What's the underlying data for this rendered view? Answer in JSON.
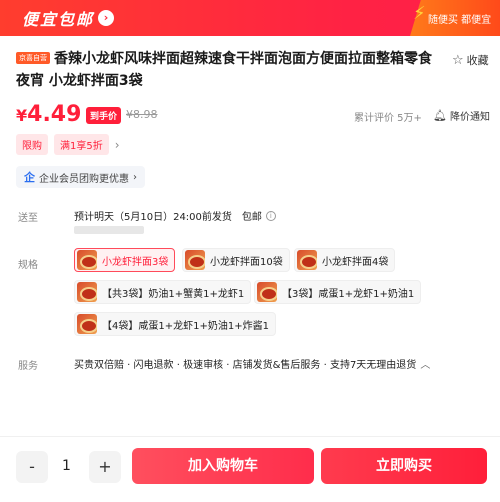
{
  "banner": {
    "title": "便宜包邮",
    "arrow": "›",
    "ribbon_text": "随便买 都便宜"
  },
  "product": {
    "self_tag": "京喜自营",
    "title": "香辣小龙虾风味拌面超辣速食干拌面泡面方便面拉面整箱零食夜宵 小龙虾拌面3袋",
    "fav_label": "收藏"
  },
  "price": {
    "currency": "¥",
    "value": "4.49",
    "hand_tag": "到手价",
    "original": "¥8.98",
    "reviews": "累计评价 5万+",
    "notify": "降价通知"
  },
  "promos": [
    "限购",
    "满1享5折"
  ],
  "corp": {
    "label": "企业会员团购更优惠",
    "chevron": "›"
  },
  "shipping": {
    "label": "送至",
    "text": "预计明天（5月10日）24:00前发货",
    "free": "包邮",
    "info": "i"
  },
  "specs": {
    "label": "规格",
    "options": [
      {
        "label": "小龙虾拌面3袋",
        "selected": true
      },
      {
        "label": "小龙虾拌面10袋",
        "selected": false
      },
      {
        "label": "小龙虾拌面4袋",
        "selected": false
      },
      {
        "label": "【共3袋】奶油1+蟹黄1+龙虾1",
        "selected": false
      },
      {
        "label": "【3袋】咸蛋1+龙虾1+奶油1",
        "selected": false
      },
      {
        "label": "【4袋】咸蛋1+龙虾1+奶油1+炸酱1",
        "selected": false
      }
    ]
  },
  "service": {
    "label": "服务",
    "text": "买贵双倍赔 · 闪电退款 · 极速审核 · 店铺发货&售后服务 · 支持7天无理由退货"
  },
  "bottom": {
    "minus": "-",
    "qty": "1",
    "plus": "+",
    "add_cart": "加入购物车",
    "buy_now": "立即购买"
  },
  "colors": {
    "accent": "#ff1f3a",
    "banner": "#ff2a3c"
  }
}
